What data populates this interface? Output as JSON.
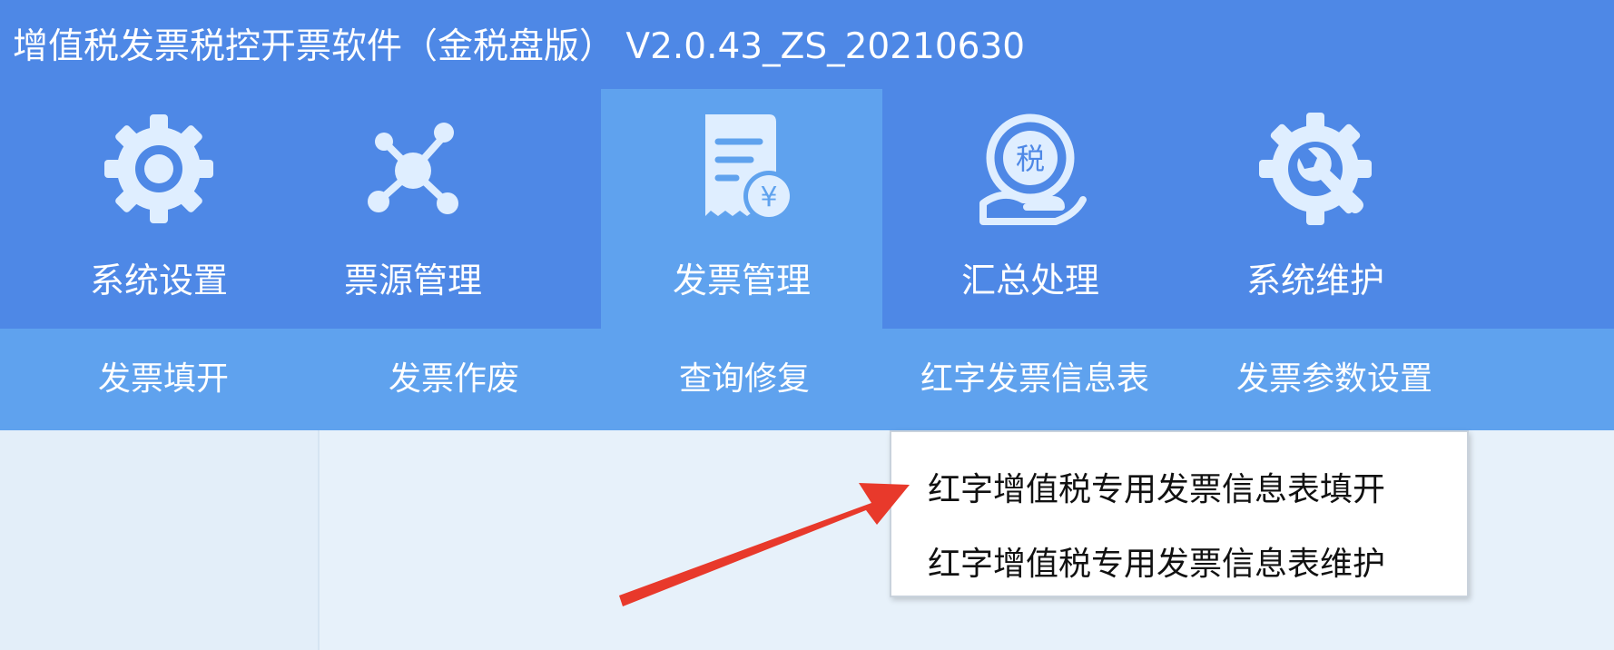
{
  "window": {
    "title": "增值税发票税控开票软件（金税盘版） V2.0.43_ZS_20210630"
  },
  "nav": {
    "items": [
      {
        "label": "系统设置",
        "icon": "gear-icon"
      },
      {
        "label": "票源管理",
        "icon": "network-icon"
      },
      {
        "label": "发票管理",
        "icon": "invoice-yen-icon",
        "active": true
      },
      {
        "label": "汇总处理",
        "icon": "tax-summary-icon"
      },
      {
        "label": "系统维护",
        "icon": "wrench-gear-icon"
      }
    ]
  },
  "subnav": {
    "items": [
      {
        "label": "发票填开"
      },
      {
        "label": "发票作废"
      },
      {
        "label": "查询修复"
      },
      {
        "label": "红字发票信息表"
      },
      {
        "label": "发票参数设置"
      }
    ]
  },
  "dropdown": {
    "items": [
      {
        "label": "红字增值税专用发票信息表填开"
      },
      {
        "label": "红字增值税专用发票信息表维护"
      }
    ]
  },
  "colors": {
    "topbar": "#4e88e6",
    "active_nav": "#5fa2ee",
    "subnav": "#5fa2ee",
    "content": "#e7f1fa",
    "annotation_arrow": "#e8392b"
  }
}
